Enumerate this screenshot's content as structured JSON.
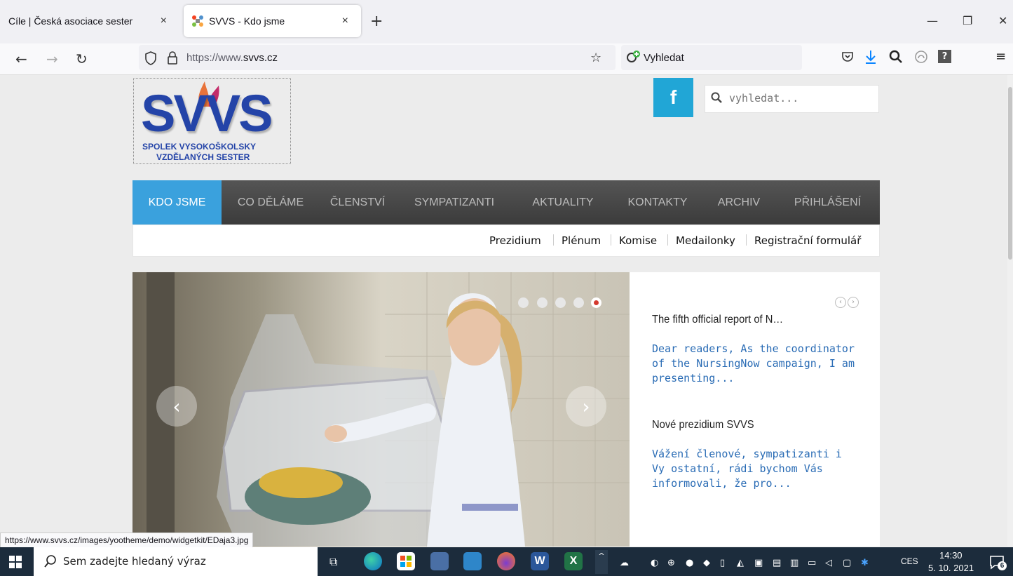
{
  "browser": {
    "tabs": [
      {
        "title": "Cíle | Česká asociace sester",
        "close": "×"
      },
      {
        "title": "SVVS - Kdo jsme",
        "close": "×"
      }
    ],
    "new_tab": "+",
    "window": {
      "minimize": "—",
      "restore": "❐",
      "close": "✕"
    },
    "nav": {
      "back": "←",
      "forward": "→",
      "reload": "↻"
    },
    "url_prefix": "https://www.",
    "url_domain": "svvs.cz",
    "search_placeholder": "Vyhledat",
    "status_url": "https://www.svvs.cz/images/yootheme/demo/widgetkit/EDaja3.jpg"
  },
  "site": {
    "logo": {
      "big": "SVVS",
      "line1": "SPOLEK VYSOKOŠKOLSKY",
      "line2": "VZDĚLANÝCH SESTER"
    },
    "facebook": "f",
    "search_placeholder": "vyhledat...",
    "main_nav": [
      "KDO JSME",
      "CO DĚLÁME",
      "ČLENSTVÍ",
      "SYMPATIZANTI",
      "AKTUALITY",
      "KONTAKTY",
      "ARCHIV",
      "PŘIHLÁŠENÍ"
    ],
    "sub_nav": [
      "Prezidium",
      "Plénum",
      "Komise",
      "Medailonky",
      "Registrační formulář"
    ],
    "slider": {
      "prev": "‹",
      "next": "›",
      "active_dot": 5,
      "dots": 5
    },
    "news": [
      {
        "title": "The fifth official report of N…",
        "text": "Dear readers, As the coordinator of the NursingNow campaign, I am presenting..."
      },
      {
        "title": "Nové prezidium SVVS",
        "text": "Vážení členové, sympatizanti i Vy ostatní, rádi bychom Vás informovali, že pro..."
      }
    ],
    "news_nav": [
      "‹",
      "›"
    ]
  },
  "taskbar": {
    "search_placeholder": "Sem zadejte hledaný výraz",
    "lang": "CES",
    "time": "14:30",
    "date": "5. 10. 2021",
    "notifications": "6"
  },
  "colors": {
    "nav_active": "#3aa1dd",
    "facebook": "#21a6d6",
    "link": "#2a6cb5",
    "logo": "#2444a8",
    "active_dot": "#d43a2f"
  }
}
